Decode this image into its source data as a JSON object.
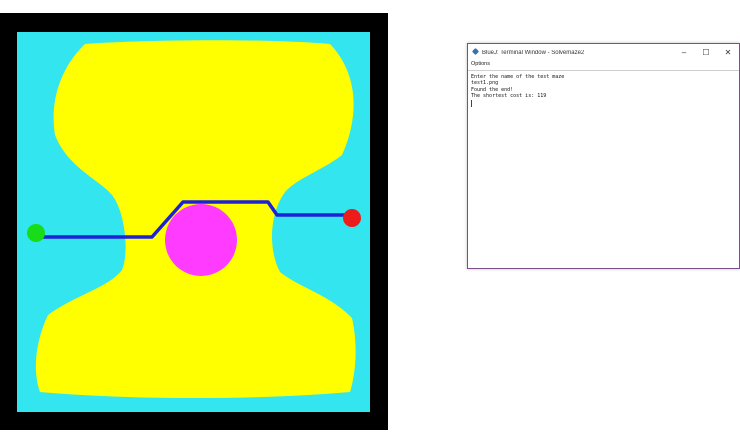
{
  "colors": {
    "frame": "#000000",
    "cyan": "#33e5ef",
    "yellow": "#ffff00",
    "magenta": "#ff3bff",
    "start": "#19dc19",
    "end": "#ee1b1b",
    "path": "#1d22d6",
    "window_border": "#7b4f8a"
  },
  "terminal": {
    "title": "BlueJ: Terminal Window - Solvemaze2",
    "icon": "bluej-icon",
    "controls": {
      "minimize": "–",
      "maximize": "☐",
      "close": "✕"
    },
    "menu": [
      "Options"
    ],
    "lines": [
      "Enter the name of the test maze",
      "test1.png",
      "Found the end!",
      "The shortest cost is: 119"
    ]
  }
}
